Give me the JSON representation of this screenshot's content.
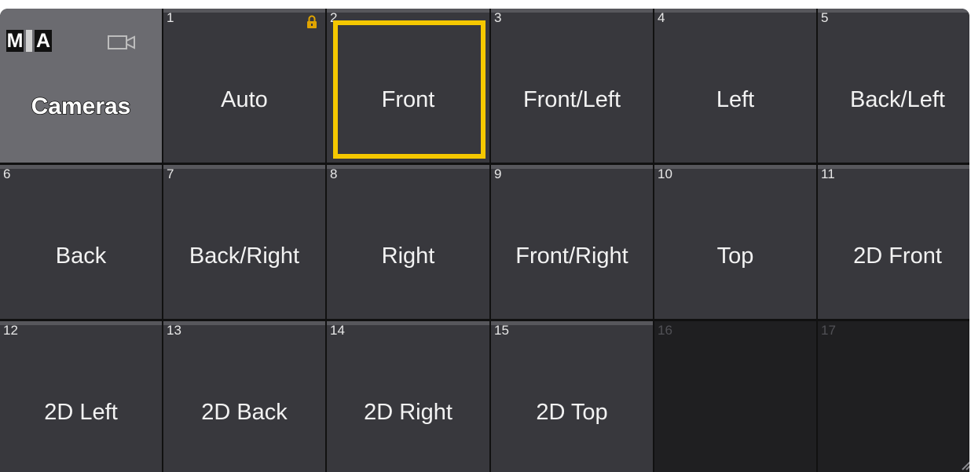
{
  "title": {
    "logo_letters": [
      "M",
      "A"
    ],
    "label": "Cameras"
  },
  "cells": [
    {
      "num": "1",
      "label": "Auto",
      "locked": true
    },
    {
      "num": "2",
      "label": "Front",
      "selected": true
    },
    {
      "num": "3",
      "label": "Front/Left"
    },
    {
      "num": "4",
      "label": "Left"
    },
    {
      "num": "5",
      "label": "Back/Left"
    },
    {
      "num": "6",
      "label": "Back"
    },
    {
      "num": "7",
      "label": "Back/Right"
    },
    {
      "num": "8",
      "label": "Right"
    },
    {
      "num": "9",
      "label": "Front/Right"
    },
    {
      "num": "10",
      "label": "Top"
    },
    {
      "num": "11",
      "label": "2D Front"
    },
    {
      "num": "12",
      "label": "2D Left"
    },
    {
      "num": "13",
      "label": "2D Back"
    },
    {
      "num": "14",
      "label": "2D Right"
    },
    {
      "num": "15",
      "label": "2D Top"
    },
    {
      "num": "16",
      "label": ""
    },
    {
      "num": "17",
      "label": ""
    }
  ],
  "colors": {
    "selection": "#f5c800",
    "lock": "#e0a400"
  }
}
